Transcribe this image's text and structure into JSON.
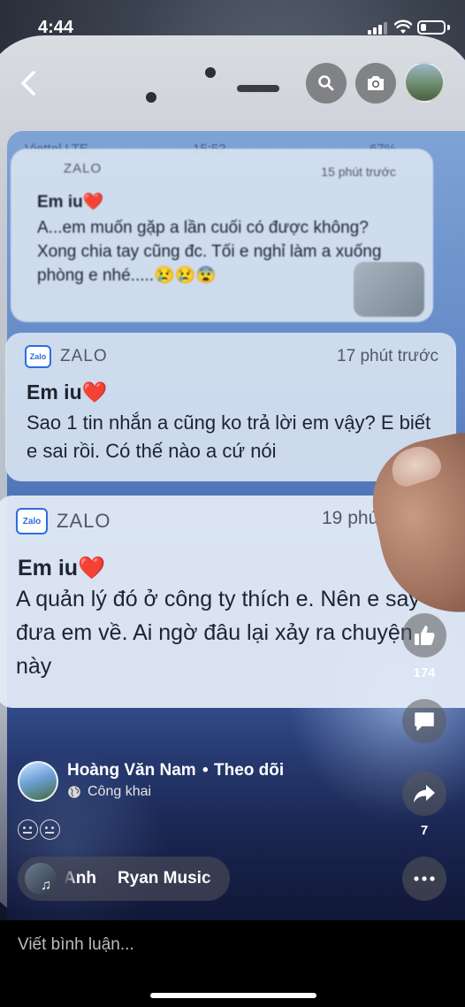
{
  "status_bar": {
    "time": "4:44",
    "battery_level": 0.25
  },
  "video": {
    "phone_status": {
      "carrier": "Viettel LTE",
      "time": "15:52",
      "battery": "67%"
    },
    "notifications": [
      {
        "app": "ZALO",
        "time": "15 phút trước",
        "sender": "Em iu",
        "body": "A...em muốn gặp a lần cuối có được không? Xong chia tay cũng đc. Tối e nghỉ làm a xuống phòng e nhé.....😢😢😨"
      },
      {
        "app": "ZALO",
        "time": "17 phút trước",
        "sender": "Em iu",
        "body": "Sao 1 tin nhắn a cũng ko trả lời em vậy? E biết e sai rồi. Có thế nào a cứ nói"
      },
      {
        "app": "ZALO",
        "time": "19 phút",
        "sender": "Em iu",
        "body": "A quản lý đó ở công ty thích e. Nên e say đưa em về. Ai ngờ đâu lại xảy ra chuyện này"
      }
    ],
    "logo_text": "Zalo",
    "heart": "❤️"
  },
  "actions": {
    "like_count": "174",
    "share_count": "7"
  },
  "post": {
    "author": "Hoàng Văn Nam",
    "separator": "•",
    "follow": "Theo dõi",
    "privacy": "Công khai"
  },
  "music": {
    "title_fragment": "Anh",
    "artist": "Ryan Music",
    "trailing": "·",
    "note": "♫"
  },
  "composer": {
    "placeholder": "Viết bình luận..."
  }
}
